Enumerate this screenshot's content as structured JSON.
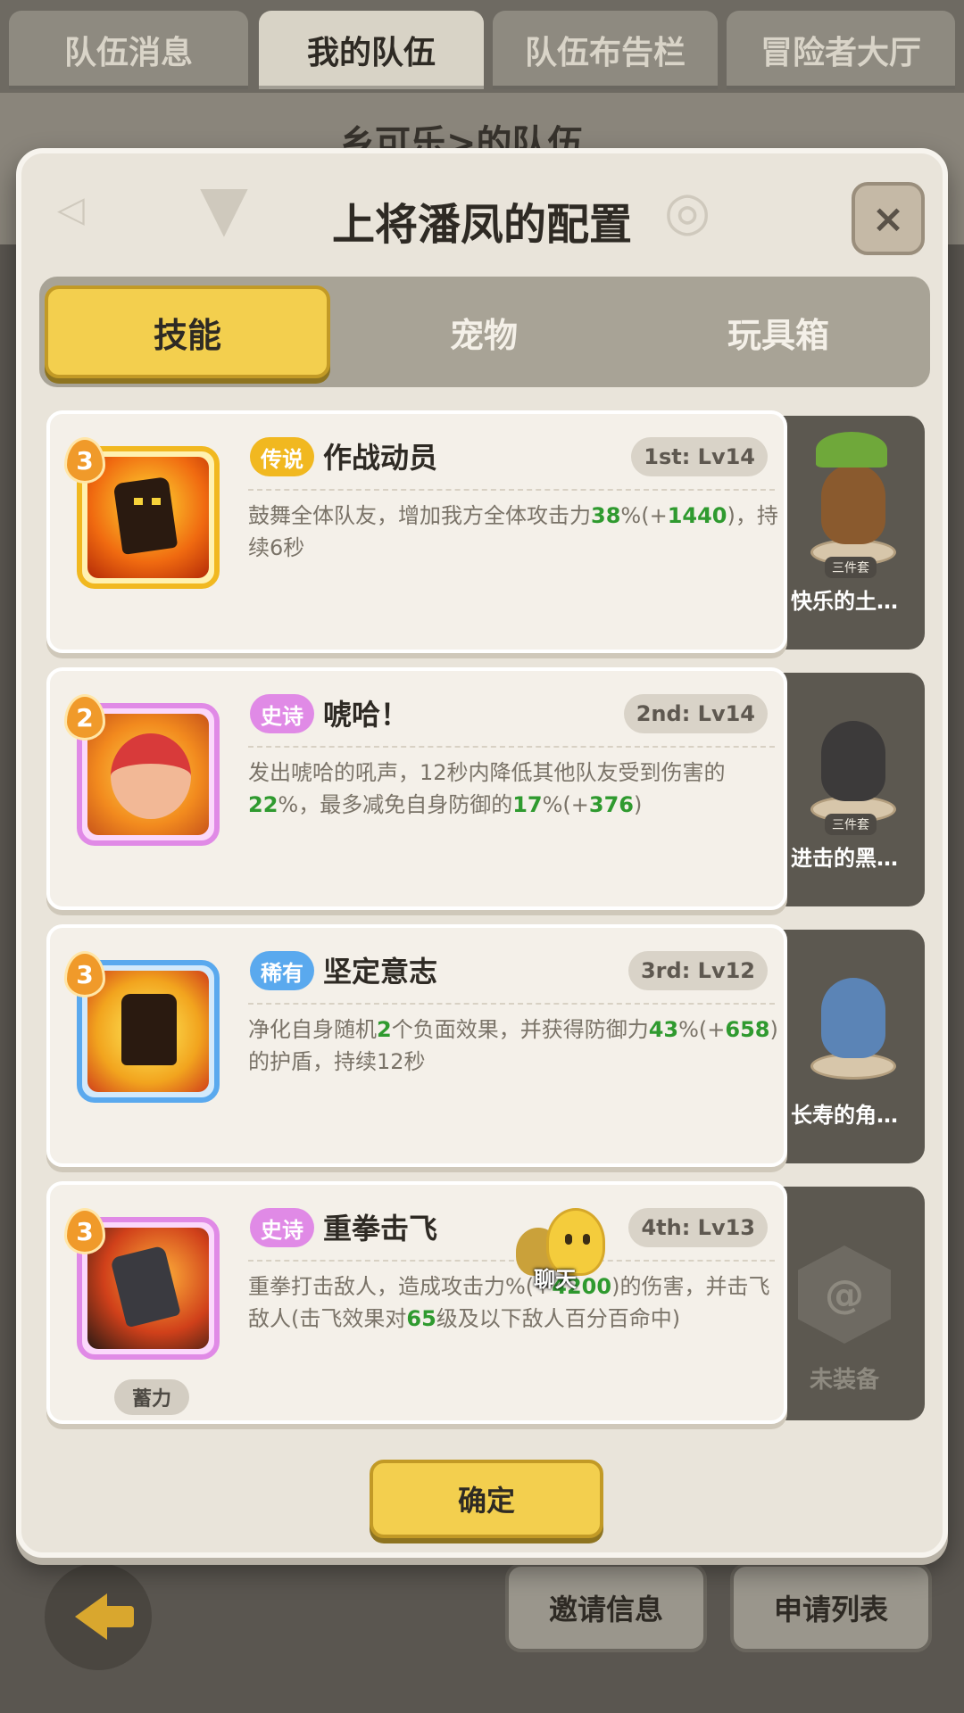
{
  "top_tabs": [
    "队伍消息",
    "我的队伍",
    "队伍布告栏",
    "冒险者大厅"
  ],
  "background_team_title": "乡可乐>的队伍",
  "modal": {
    "title": "上将潘凤的配置",
    "close_label": "×",
    "sub_tabs": [
      "技能",
      "宠物",
      "玩具箱"
    ],
    "confirm_label": "确定"
  },
  "skills": [
    {
      "level": "3",
      "rarity": "传说",
      "name": "作战动员",
      "slot": "1st: Lv14",
      "desc_parts": [
        {
          "t": "鼓舞全体队友，增加我方全体攻击力"
        },
        {
          "t": "38",
          "hl": true
        },
        {
          "t": "%(+"
        },
        {
          "t": "1440",
          "hl": true
        },
        {
          "t": ")，持续6秒"
        }
      ],
      "pet_name": "快乐的土…",
      "pet_tag": "三件套"
    },
    {
      "level": "2",
      "rarity": "史诗",
      "name": "唬哈！",
      "slot": "2nd: Lv14",
      "desc_parts": [
        {
          "t": "发出唬哈的吼声，12秒内降低其他队友受到伤害的"
        },
        {
          "t": "22",
          "hl": true
        },
        {
          "t": "%，最多减免自身防御的"
        },
        {
          "t": "17",
          "hl": true
        },
        {
          "t": "%(+"
        },
        {
          "t": "376",
          "hl": true
        },
        {
          "t": ")"
        }
      ],
      "pet_name": "进击的黑…",
      "pet_tag": "三件套"
    },
    {
      "level": "3",
      "rarity": "稀有",
      "name": "坚定意志",
      "slot": "3rd: Lv12",
      "desc_parts": [
        {
          "t": "净化自身随机"
        },
        {
          "t": "2",
          "hl": true
        },
        {
          "t": "个负面效果，并获得防御力"
        },
        {
          "t": "43",
          "hl": true
        },
        {
          "t": "%(+"
        },
        {
          "t": "658",
          "hl": true
        },
        {
          "t": ")的护盾，持续12秒"
        }
      ],
      "pet_name": "长寿的角…",
      "pet_tag": ""
    },
    {
      "level": "3",
      "rarity": "史诗",
      "name": "重拳击飞",
      "slot": "4th: Lv13",
      "desc_parts": [
        {
          "t": "重拳打击敌人，造成攻击力"
        },
        {
          "t": "%(+"
        },
        {
          "t": "4200",
          "hl": true
        },
        {
          "t": ")的伤害，并击飞敌人(击飞效果对"
        },
        {
          "t": "65",
          "hl": true
        },
        {
          "t": "级及以下敌人百分百命中)"
        }
      ],
      "charge_label": "蓄力",
      "pet_name": "",
      "empty_label": "未装备"
    }
  ],
  "chat_label": "聊天",
  "bottom": {
    "invite_label": "邀请信息",
    "apply_label": "申请列表"
  },
  "colors": {
    "legendary": "#f1b820",
    "epic": "#e08ae6",
    "rare": "#5aa9ee",
    "highlight": "#2f9a2f",
    "accent_yellow": "#f3cf4e"
  }
}
